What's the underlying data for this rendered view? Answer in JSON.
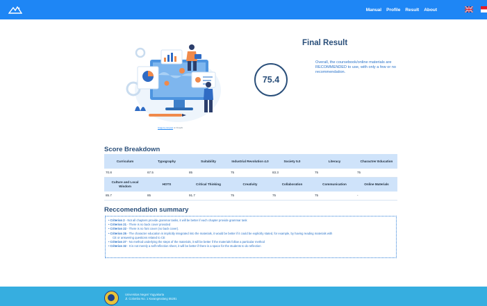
{
  "nav": {
    "links": [
      "Manual",
      "Profile",
      "Result",
      "About"
    ],
    "languages": [
      "English",
      "Indonesian"
    ]
  },
  "hero": {
    "caption_link": "Image by storyset",
    "caption_suffix": " on Freepik"
  },
  "result": {
    "title": "Final Result",
    "score": "75.4",
    "description": "Overall, the coursebook/online materials are RECOMMENDED to use, with only a few or no recommendation."
  },
  "breakdown": {
    "title": "Score Breakdown",
    "rows": [
      {
        "headers": [
          "Curriculum",
          "Typography",
          "Suitability",
          "Industrial Revolution 4.0",
          "Society 5.0",
          "Literacy",
          "Charactrer Education"
        ],
        "values": [
          "70.8",
          "67.5",
          "85",
          "75",
          "83.3",
          "75",
          "75"
        ]
      },
      {
        "headers": [
          "Culture and Local Wisdom",
          "HOTS",
          "Critical Thinking",
          "Creativity",
          "Collaboration",
          "Communication",
          "Online Materials"
        ],
        "values": [
          "85.7",
          "85",
          "91.7",
          "75",
          "75",
          "75",
          "-"
        ]
      }
    ]
  },
  "recommendation": {
    "title": "Reccomendation summary",
    "items": [
      {
        "criterion": "Criterion 2",
        "text": " - Not all chapters provide grammar tasks, it will be better if each chapter provide grammar task"
      },
      {
        "criterion": "Criterion 21",
        "text": " - There is no back cover provided"
      },
      {
        "criterion": "Criterion 22",
        "text": " - There is no font cover (no back cover)."
      },
      {
        "criterion": "Criterion 25",
        "text": " - The character education is implicitly integrated into the materials, it would be better if it could be explicitly stated, for example, by having reading materials with",
        "cont": "CE or answering questions related to CE"
      },
      {
        "criterion": "Criterion 27",
        "text": " - No method underlying the steps of the materials, it will be better if the materials follow a particular method"
      },
      {
        "criterion": "Criterion 32",
        "text": " - It is not merely a self-reflection sheet, it will be better if there is a space for the students to do reflection"
      }
    ]
  },
  "footer": {
    "line1": "Universitas Negeri Yogyakarta",
    "line2": "Jl. Colombo No. 1 Karangmalang 55281"
  },
  "colors": {
    "navbar": "#1e86f5",
    "title": "#2a4f7a",
    "accent_text": "#2a73c9",
    "table_header": "#cfe3fa",
    "footer": "#36aee0"
  }
}
